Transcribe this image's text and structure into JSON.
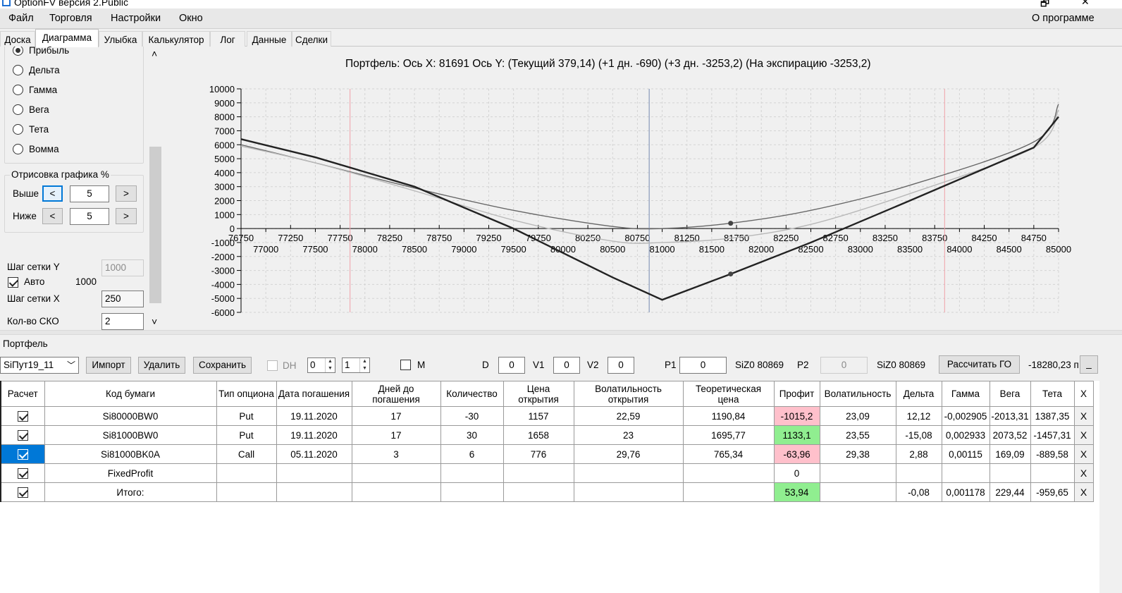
{
  "window": {
    "title": "OptionFV версия 2.Public",
    "minimize": "🗗",
    "close": "✕"
  },
  "menu": {
    "items": [
      "Файл",
      "Торговля",
      "Настройки",
      "Окно"
    ],
    "about": "О программе"
  },
  "tabs": [
    "Доска",
    "Диаграмма",
    "Улыбка",
    "Калькулятор",
    "Лог",
    "Данные",
    "Сделки"
  ],
  "active_tab": "Диаграмма",
  "left_panel": {
    "radios": [
      {
        "label": "Прибыль",
        "checked": true
      },
      {
        "label": "Дельта",
        "checked": false
      },
      {
        "label": "Гамма",
        "checked": false
      },
      {
        "label": "Вега",
        "checked": false
      },
      {
        "label": "Тета",
        "checked": false
      },
      {
        "label": "Вомма",
        "checked": false
      }
    ],
    "draw_group": {
      "title": "Отрисовка графика %",
      "above_label": "Выше",
      "above_value": "5",
      "below_label": "Ниже",
      "below_value": "5",
      "prev": "<",
      "next": ">"
    },
    "grid_step_y_label": "Шаг сетки Y",
    "grid_step_y_value": "1000",
    "auto_label": "Авто",
    "auto_value": "1000",
    "grid_step_x_label": "Шаг сетки X",
    "grid_step_x_value": "250",
    "sko_label": "Кол-во СКО",
    "sko_value": "2",
    "scroll_up": "˄",
    "scroll_down": "˅"
  },
  "chart_data": {
    "type": "line",
    "title": "Портфель:  Ось X:  81691 Ось Y:   (Текущий 379,14)  (+1 дн. -690)  (+3 дн. -3253,2)  (На экспирацию -3253,2)",
    "xlim": [
      76750,
      85000
    ],
    "ylim": [
      -6000,
      10000
    ],
    "yticks": [
      10000,
      9000,
      8000,
      7000,
      6000,
      5000,
      4000,
      3000,
      2000,
      1000,
      0,
      -1000,
      -2000,
      -3000,
      -4000,
      -5000,
      -6000
    ],
    "xticks_top": [
      76750,
      77250,
      77750,
      78250,
      78750,
      79250,
      79750,
      80250,
      80750,
      81250,
      81750,
      82250,
      82750,
      83250,
      83750,
      84250,
      84750
    ],
    "xticks_bottom": [
      77000,
      77500,
      78000,
      78500,
      79000,
      79500,
      80000,
      80500,
      81000,
      81500,
      82000,
      82500,
      83000,
      83500,
      84000,
      84500,
      85000
    ],
    "grid": true,
    "current_x": 80869,
    "sigma_lines": [
      77850,
      83850
    ],
    "colors": {
      "current": "#666666",
      "plus1": "#b8b8b8",
      "expiry": "#222222",
      "cursor": "#8899bb",
      "sigma": "#f0a0a8"
    },
    "series": [
      {
        "points": [
          [
            76750,
            6000
          ],
          [
            77500,
            4700
          ],
          [
            78500,
            2900
          ],
          [
            79500,
            1300
          ],
          [
            80500,
            150
          ],
          [
            81000,
            0
          ],
          [
            81691,
            380
          ],
          [
            82500,
            1300
          ],
          [
            83500,
            3100
          ],
          [
            84750,
            6200
          ],
          [
            85000,
            8900
          ]
        ]
      },
      {
        "points": [
          [
            76750,
            5900
          ],
          [
            77500,
            4700
          ],
          [
            78500,
            2700
          ],
          [
            79500,
            600
          ],
          [
            80500,
            -900
          ],
          [
            81000,
            -1000
          ],
          [
            81691,
            -690
          ],
          [
            82500,
            300
          ],
          [
            83500,
            2500
          ],
          [
            84750,
            5800
          ],
          [
            85000,
            8500
          ]
        ]
      },
      {
        "points": [
          [
            76750,
            6400
          ],
          [
            77500,
            5100
          ],
          [
            78500,
            3000
          ],
          [
            79500,
            0
          ],
          [
            80500,
            -3500
          ],
          [
            81000,
            -5100
          ],
          [
            81691,
            -3253.2
          ],
          [
            82500,
            -1000
          ],
          [
            83500,
            2000
          ],
          [
            84750,
            5800
          ],
          [
            85000,
            8000
          ]
        ]
      }
    ],
    "markers": [
      [
        81691,
        380
      ],
      [
        81691,
        -3253.2
      ]
    ]
  },
  "portfolio": {
    "label": "Портфель",
    "select_value": "SiПут19_11",
    "import_btn": "Импорт",
    "delete_btn": "Удалить",
    "save_btn": "Сохранить",
    "dh_label": "DH",
    "spin1": "0",
    "spin2": "1",
    "m_label": "M",
    "d_label": "D",
    "d_value": "0",
    "v1_label": "V1",
    "v1_value": "0",
    "v2_label": "V2",
    "v2_value": "0",
    "p1_label": "P1",
    "p1_value": "0",
    "siz1": "SiZ0 80869",
    "p2_label": "P2",
    "p2_value": "0",
    "siz2": "SiZ0 80869",
    "calc_go_btn": "Рассчитать ГО",
    "go_value": "-18280,23 п",
    "collapse_btn": "_"
  },
  "grid": {
    "headers": [
      "Расчет",
      "Код бумаги",
      "Тип опциона",
      "Дата погашения",
      "Дней до погашения",
      "Количество",
      "Цена открытия",
      "Волатильность открытия",
      "Теоретическая цена",
      "Профит",
      "Волатильность",
      "Дельта",
      "Гамма",
      "Вега",
      "Тета",
      "X"
    ],
    "rows": [
      {
        "code": "Si80000BW0",
        "type": "Put",
        "date": "19.11.2020",
        "days": "17",
        "qty": "-30",
        "open_price": "1157",
        "open_vol": "22,59",
        "theo": "1190,84",
        "profit": "-1015,2",
        "vol": "23,09",
        "delta": "12,12",
        "gamma": "-0,002905",
        "vega": "-2013,31",
        "theta": "1387,35",
        "x": "X"
      },
      {
        "code": "Si81000BW0",
        "type": "Put",
        "date": "19.11.2020",
        "days": "17",
        "qty": "30",
        "open_price": "1658",
        "open_vol": "23",
        "theo": "1695,77",
        "profit": "1133,1",
        "vol": "23,55",
        "delta": "-15,08",
        "gamma": "0,002933",
        "vega": "2073,52",
        "theta": "-1457,31",
        "x": "X"
      },
      {
        "code": "Si81000BK0A",
        "type": "Call",
        "date": "05.11.2020",
        "days": "3",
        "qty": "6",
        "open_price": "776",
        "open_vol": "29,76",
        "theo": "765,34",
        "profit": "-63,96",
        "vol": "29,38",
        "delta": "2,88",
        "gamma": "0,00115",
        "vega": "169,09",
        "theta": "-889,58",
        "x": "X"
      },
      {
        "code": "FixedProfit",
        "type": "",
        "date": "",
        "days": "",
        "qty": "",
        "open_price": "",
        "open_vol": "",
        "theo": "",
        "profit": "0",
        "vol": "",
        "delta": "",
        "gamma": "",
        "vega": "",
        "theta": "",
        "x": "X"
      },
      {
        "code": "Итого:",
        "type": "",
        "date": "",
        "days": "",
        "qty": "",
        "open_price": "",
        "open_vol": "",
        "theo": "",
        "profit": "53,94",
        "vol": "",
        "delta": "-0,08",
        "gamma": "0,001178",
        "vega": "229,44",
        "theta": "-959,65",
        "x": "X"
      }
    ]
  }
}
